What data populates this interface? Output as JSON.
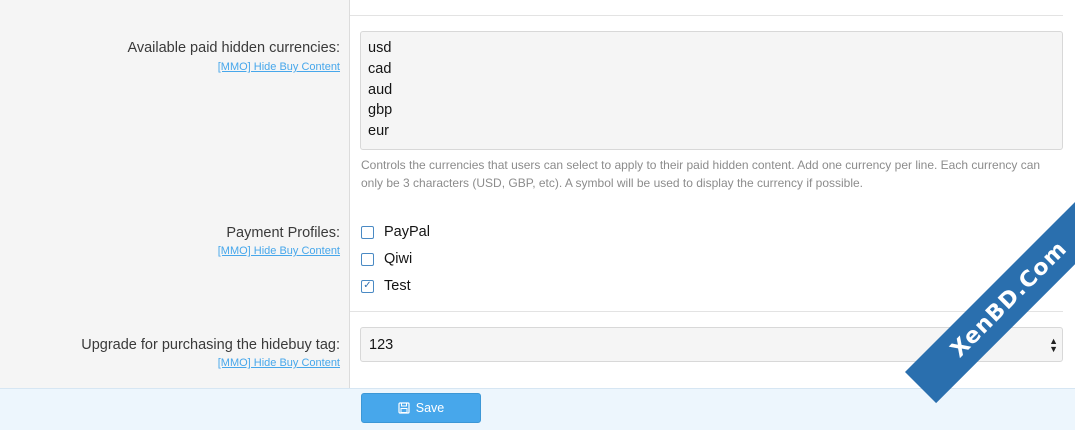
{
  "currencies": {
    "label": "Available paid hidden currencies:",
    "addon_link": "[MMO] Hide Buy Content",
    "values": [
      "usd",
      "cad",
      "aud",
      "gbp",
      "eur"
    ],
    "explain": "Controls the currencies that users can select to apply to their paid hidden content. Add one currency per line. Each currency can only be 3 characters (USD, GBP, etc). A symbol will be used to display the currency if possible."
  },
  "payment_profiles": {
    "label": "Payment Profiles:",
    "addon_link": "[MMO] Hide Buy Content",
    "options": [
      {
        "label": "PayPal",
        "checked": false
      },
      {
        "label": "Qiwi",
        "checked": false
      },
      {
        "label": "Test",
        "checked": true
      }
    ]
  },
  "upgrade": {
    "label": "Upgrade for purchasing the hidebuy tag:",
    "addon_link": "[MMO] Hide Buy Content",
    "selected": "123"
  },
  "footer": {
    "save_label": "Save"
  },
  "watermark": {
    "text": "XenBD.Com"
  },
  "colors": {
    "accent": "#47a7eb",
    "footer_bg": "#edf6fd",
    "left_panel": "#f5f5f5",
    "watermark": "#2a6fae"
  },
  "icons": {
    "save": "save-icon",
    "checkbox_check": "check-icon",
    "select_arrows": "select-arrows-icon"
  }
}
